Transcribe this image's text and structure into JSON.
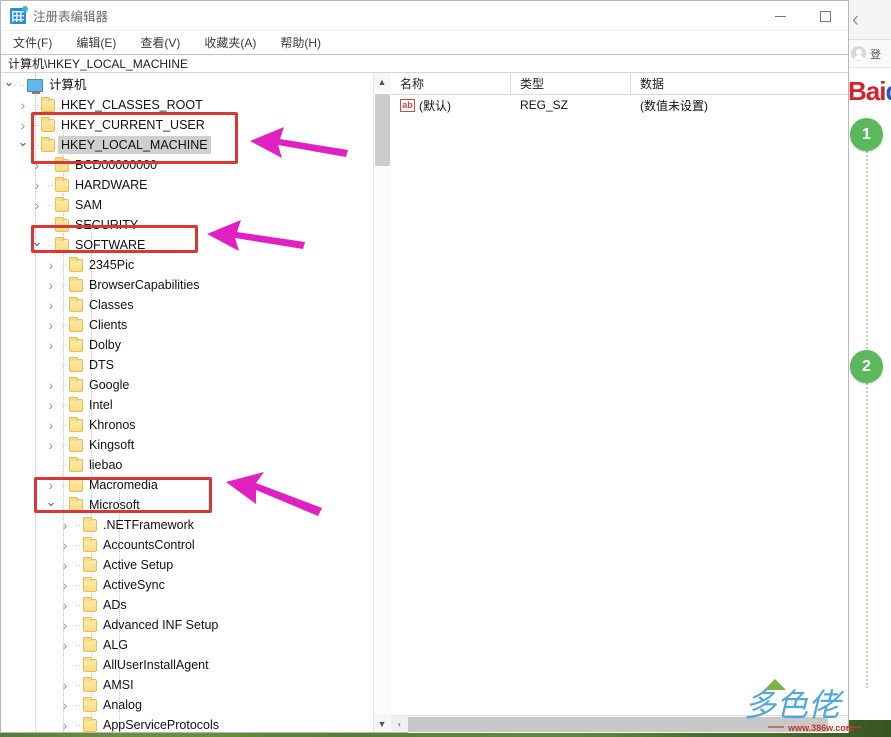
{
  "window": {
    "title": "注册表编辑器",
    "app_icon": "registry-editor-icon",
    "minimize_label": "最小化",
    "maximize_label": "最大化"
  },
  "menubar": {
    "items": [
      {
        "label": "文件(F)"
      },
      {
        "label": "编辑(E)"
      },
      {
        "label": "查看(V)"
      },
      {
        "label": "收藏夹(A)"
      },
      {
        "label": "帮助(H)"
      }
    ]
  },
  "addressbar": {
    "path": "计算机\\HKEY_LOCAL_MACHINE"
  },
  "tree": {
    "rows": [
      {
        "label": "计算机",
        "indent": 0,
        "state": "open",
        "icon": "computer-icon",
        "selected": false
      },
      {
        "label": "HKEY_CLASSES_ROOT",
        "indent": 1,
        "state": "closed",
        "icon": "folder-icon",
        "selected": false
      },
      {
        "label": "HKEY_CURRENT_USER",
        "indent": 1,
        "state": "closed",
        "icon": "folder-icon",
        "selected": false
      },
      {
        "label": "HKEY_LOCAL_MACHINE",
        "indent": 1,
        "state": "open",
        "icon": "folder-icon",
        "selected": true
      },
      {
        "label": "BCD00000000",
        "indent": 2,
        "state": "closed",
        "icon": "folder-icon",
        "selected": false
      },
      {
        "label": "HARDWARE",
        "indent": 2,
        "state": "closed",
        "icon": "folder-icon",
        "selected": false
      },
      {
        "label": "SAM",
        "indent": 2,
        "state": "closed",
        "icon": "folder-icon",
        "selected": false
      },
      {
        "label": "SECURITY",
        "indent": 2,
        "state": "leaf",
        "icon": "folder-icon",
        "selected": false
      },
      {
        "label": "SOFTWARE",
        "indent": 2,
        "state": "open",
        "icon": "folder-icon",
        "selected": false
      },
      {
        "label": "2345Pic",
        "indent": 3,
        "state": "closed",
        "icon": "folder-icon",
        "selected": false
      },
      {
        "label": "BrowserCapabilities",
        "indent": 3,
        "state": "closed",
        "icon": "folder-icon",
        "selected": false
      },
      {
        "label": "Classes",
        "indent": 3,
        "state": "closed",
        "icon": "folder-icon",
        "selected": false
      },
      {
        "label": "Clients",
        "indent": 3,
        "state": "closed",
        "icon": "folder-icon",
        "selected": false
      },
      {
        "label": "Dolby",
        "indent": 3,
        "state": "closed",
        "icon": "folder-icon",
        "selected": false
      },
      {
        "label": "DTS",
        "indent": 3,
        "state": "leaf",
        "icon": "folder-icon",
        "selected": false
      },
      {
        "label": "Google",
        "indent": 3,
        "state": "closed",
        "icon": "folder-icon",
        "selected": false
      },
      {
        "label": "Intel",
        "indent": 3,
        "state": "closed",
        "icon": "folder-icon",
        "selected": false
      },
      {
        "label": "Khronos",
        "indent": 3,
        "state": "closed",
        "icon": "folder-icon",
        "selected": false
      },
      {
        "label": "Kingsoft",
        "indent": 3,
        "state": "closed",
        "icon": "folder-icon",
        "selected": false
      },
      {
        "label": "liebao",
        "indent": 3,
        "state": "leaf",
        "icon": "folder-icon",
        "selected": false
      },
      {
        "label": "Macromedia",
        "indent": 3,
        "state": "closed",
        "icon": "folder-icon",
        "selected": false
      },
      {
        "label": "Microsoft",
        "indent": 3,
        "state": "open",
        "icon": "folder-icon",
        "selected": false
      },
      {
        "label": ".NETFramework",
        "indent": 4,
        "state": "closed",
        "icon": "folder-icon",
        "selected": false
      },
      {
        "label": "AccountsControl",
        "indent": 4,
        "state": "closed",
        "icon": "folder-icon",
        "selected": false
      },
      {
        "label": "Active Setup",
        "indent": 4,
        "state": "closed",
        "icon": "folder-icon",
        "selected": false
      },
      {
        "label": "ActiveSync",
        "indent": 4,
        "state": "closed",
        "icon": "folder-icon",
        "selected": false
      },
      {
        "label": "ADs",
        "indent": 4,
        "state": "closed",
        "icon": "folder-icon",
        "selected": false
      },
      {
        "label": "Advanced INF Setup",
        "indent": 4,
        "state": "closed",
        "icon": "folder-icon",
        "selected": false
      },
      {
        "label": "ALG",
        "indent": 4,
        "state": "closed",
        "icon": "folder-icon",
        "selected": false
      },
      {
        "label": "AllUserInstallAgent",
        "indent": 4,
        "state": "leaf",
        "icon": "folder-icon",
        "selected": false
      },
      {
        "label": "AMSI",
        "indent": 4,
        "state": "closed",
        "icon": "folder-icon",
        "selected": false
      },
      {
        "label": "Analog",
        "indent": 4,
        "state": "closed",
        "icon": "folder-icon",
        "selected": false
      },
      {
        "label": "AppServiceProtocols",
        "indent": 4,
        "state": "closed",
        "icon": "folder-icon",
        "selected": false
      }
    ],
    "scroll_up_glyph": "▲",
    "scroll_down_glyph": "▼"
  },
  "values": {
    "columns": {
      "name": "名称",
      "type": "类型",
      "data": "数据"
    },
    "rows": [
      {
        "name": "(默认)",
        "type": "REG_SZ",
        "data": "(数值未设置)",
        "icon": "ab-string-icon"
      }
    ],
    "hscroll_left_glyph": "‹"
  },
  "annotations": {
    "boxes": [
      {
        "name": "highlight-hkey-local-machine",
        "color": "#d93636"
      },
      {
        "name": "highlight-software",
        "color": "#d93636"
      },
      {
        "name": "highlight-microsoft",
        "color": "#d93636"
      }
    ],
    "arrows": [
      {
        "name": "arrow-to-hkey-local-machine",
        "color": "#e020c0"
      },
      {
        "name": "arrow-to-software",
        "color": "#e020c0"
      },
      {
        "name": "arrow-to-microsoft",
        "color": "#e020c0"
      }
    ]
  },
  "browser": {
    "back_glyph": "‹",
    "login_label": "登",
    "logo_part1": "Bai",
    "logo_part2": "d",
    "steps": [
      {
        "number": "1"
      },
      {
        "number": "2"
      }
    ]
  },
  "watermark": {
    "text": "多色佬",
    "url": "www.386w.com"
  },
  "colors": {
    "annotation_red": "#d93636",
    "annotation_magenta": "#e020c0",
    "step_green": "#5cb85c",
    "baidu_red": "#d0232b",
    "baidu_blue": "#2b51c4",
    "selection_gray": "#cfcfcf",
    "folder_yellow": "#fbdc82"
  }
}
